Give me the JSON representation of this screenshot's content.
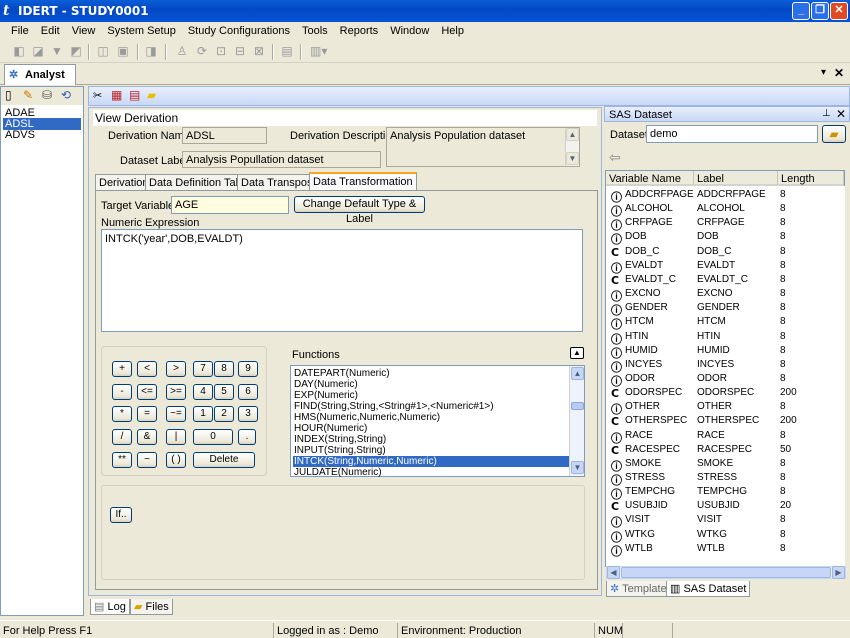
{
  "window": {
    "title": "IDERT - STUDY0001"
  },
  "menu": [
    "File",
    "Edit",
    "View",
    "System Setup",
    "Study Configurations",
    "Tools",
    "Reports",
    "Window",
    "Help"
  ],
  "perspective": {
    "tab_label": "Analyst"
  },
  "datasets": [
    "ADAE",
    "ADSL",
    "ADVS"
  ],
  "selected_dataset": "ADSL",
  "view": {
    "title": "View Derivation",
    "derivation_name_label": "Derivation Name",
    "derivation_name": "ADSL",
    "derivation_description_label": "Derivation Description",
    "derivation_description": "Analysis Population dataset",
    "dataset_label_label": "Dataset Label",
    "dataset_label": "Analysis Popullation dataset"
  },
  "tabs": [
    "Derivation",
    "Data Definition Table",
    "Data Transpose",
    "Data Transformation"
  ],
  "active_tab": "Data Transformation",
  "transformation": {
    "target_variable_label": "Target Variable",
    "target_variable": "AGE",
    "change_default_button": "Change Default Type & Label",
    "numeric_expression_label": "Numeric Expression",
    "expression": "INTCK('year',DOB,EVALDT)"
  },
  "keypad": [
    [
      "+",
      "<",
      ">",
      "7",
      "8",
      "9"
    ],
    [
      "-",
      "<=",
      ">=",
      "4",
      "5",
      "6"
    ],
    [
      "*",
      "=",
      "~=",
      "1",
      "2",
      "3"
    ],
    [
      "/",
      "&",
      "|",
      "0",
      "."
    ],
    [
      "**",
      "~",
      "( )",
      "Delete"
    ]
  ],
  "functions": {
    "label": "Functions",
    "items": [
      "DATEPART(Numeric)",
      "DAY(Numeric)",
      "EXP(Numeric)",
      "FIND(String,String,<String#1>,<Numeric#1>)",
      "HMS(Numeric,Numeric,Numeric)",
      "HOUR(Numeric)",
      "INDEX(String,String)",
      "INPUT(String,String)",
      "INTCK(String,Numeric,Numeric)",
      "JULDATE(Numeric)"
    ],
    "selected": "INTCK(String,Numeric,Numeric)"
  },
  "if_button": "If..",
  "sas_panel": {
    "title": "SAS Dataset",
    "dataset_label": "Dataset",
    "dataset_value": "demo",
    "columns": [
      "Variable Name",
      "Label",
      "Length"
    ],
    "rows": [
      {
        "type": "N",
        "name": "ADDCRFPAGE",
        "label": "ADDCRFPAGE",
        "length": "8"
      },
      {
        "type": "N",
        "name": "ALCOHOL",
        "label": "ALCOHOL",
        "length": "8"
      },
      {
        "type": "N",
        "name": "CRFPAGE",
        "label": "CRFPAGE",
        "length": "8"
      },
      {
        "type": "N",
        "name": "DOB",
        "label": "DOB",
        "length": "8"
      },
      {
        "type": "C",
        "name": "DOB_C",
        "label": "DOB_C",
        "length": "8"
      },
      {
        "type": "N",
        "name": "EVALDT",
        "label": "EVALDT",
        "length": "8"
      },
      {
        "type": "C",
        "name": "EVALDT_C",
        "label": "EVALDT_C",
        "length": "8"
      },
      {
        "type": "N",
        "name": "EXCNO",
        "label": "EXCNO",
        "length": "8"
      },
      {
        "type": "N",
        "name": "GENDER",
        "label": "GENDER",
        "length": "8"
      },
      {
        "type": "N",
        "name": "HTCM",
        "label": "HTCM",
        "length": "8"
      },
      {
        "type": "N",
        "name": "HTIN",
        "label": "HTIN",
        "length": "8"
      },
      {
        "type": "N",
        "name": "HUMID",
        "label": "HUMID",
        "length": "8"
      },
      {
        "type": "N",
        "name": "INCYES",
        "label": "INCYES",
        "length": "8"
      },
      {
        "type": "N",
        "name": "ODOR",
        "label": "ODOR",
        "length": "8"
      },
      {
        "type": "C",
        "name": "ODORSPEC",
        "label": "ODORSPEC",
        "length": "200"
      },
      {
        "type": "N",
        "name": "OTHER",
        "label": "OTHER",
        "length": "8"
      },
      {
        "type": "C",
        "name": "OTHERSPEC",
        "label": "OTHERSPEC",
        "length": "200"
      },
      {
        "type": "N",
        "name": "RACE",
        "label": "RACE",
        "length": "8"
      },
      {
        "type": "C",
        "name": "RACESPEC",
        "label": "RACESPEC",
        "length": "50"
      },
      {
        "type": "N",
        "name": "SMOKE",
        "label": "SMOKE",
        "length": "8"
      },
      {
        "type": "N",
        "name": "STRESS",
        "label": "STRESS",
        "length": "8"
      },
      {
        "type": "N",
        "name": "TEMPCHG",
        "label": "TEMPCHG",
        "length": "8"
      },
      {
        "type": "C",
        "name": "USUBJID",
        "label": "USUBJID",
        "length": "20"
      },
      {
        "type": "N",
        "name": "VISIT",
        "label": "VISIT",
        "length": "8"
      },
      {
        "type": "N",
        "name": "WTKG",
        "label": "WTKG",
        "length": "8"
      },
      {
        "type": "N",
        "name": "WTLB",
        "label": "WTLB",
        "length": "8"
      }
    ],
    "bottom_tabs": [
      "Template",
      "SAS Dataset"
    ]
  },
  "log_tabs": [
    "Log",
    "Files"
  ],
  "status": {
    "help": "For Help Press F1",
    "user": "Logged in as : Demo",
    "environment": "Environment: Production",
    "num": "NUM"
  }
}
